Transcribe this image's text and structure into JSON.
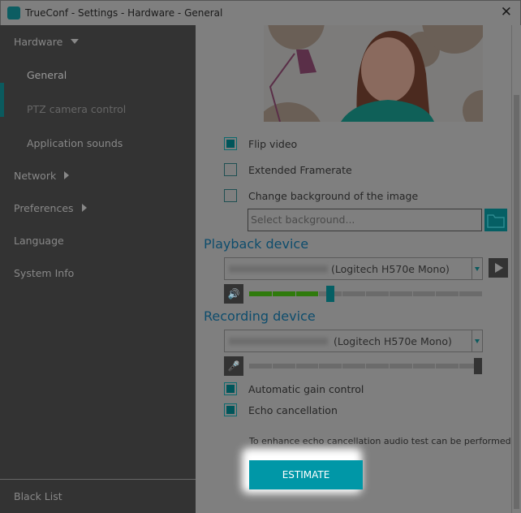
{
  "window": {
    "title": "TrueConf - Settings - Hardware - General",
    "logo_icon": "trueconf-paw-icon",
    "close_icon": "close-icon",
    "close_glyph": "✕"
  },
  "sidebar": {
    "items": [
      {
        "label": "Hardware",
        "expanded": true
      },
      {
        "label": "General",
        "selected": true
      },
      {
        "label": "PTZ camera control",
        "disabled": true
      },
      {
        "label": "Application sounds"
      },
      {
        "label": "Network"
      },
      {
        "label": "Preferences"
      },
      {
        "label": "Language"
      },
      {
        "label": "System Info"
      }
    ],
    "bottom": {
      "label": "Black List"
    }
  },
  "video": {
    "flip": {
      "label": "Flip video",
      "checked": true
    },
    "framerate": {
      "label": "Extended Framerate",
      "checked": false
    },
    "background": {
      "label": "Change background of the image",
      "checked": false,
      "placeholder": "Select background..."
    }
  },
  "playback": {
    "heading": "Playback device",
    "device": "(Logitech H570e Mono)",
    "volume_percent": 35
  },
  "recording": {
    "heading": "Recording device",
    "device": "(Logitech H570e Mono)",
    "volume_percent": 100,
    "agc": {
      "label": "Automatic gain control",
      "checked": true
    },
    "echo": {
      "label": "Echo cancellation",
      "checked": true
    },
    "note": "To enhance echo cancellation audio test can be performed",
    "estimate_label": "ESTIMATE"
  },
  "colors": {
    "accent": "#0097a7",
    "heading": "#0e4d6d",
    "level": "#2f7a0c"
  }
}
